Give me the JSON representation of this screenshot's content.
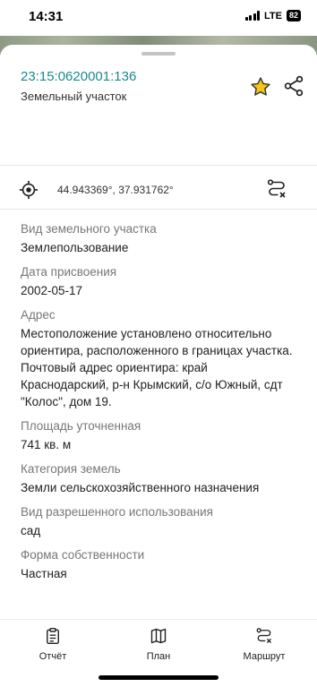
{
  "status_bar": {
    "time": "14:31",
    "network": "LTE",
    "battery": "82"
  },
  "parcel": {
    "cadastral_number": "23:15:0620001:136",
    "object_type": "Земельный участок",
    "coordinates": "44.943369°, 37.931762°",
    "accent_color": "#1a8a8a",
    "favorite_color": "#f5c518"
  },
  "details": [
    {
      "label": "Вид земельного участка",
      "value": "Землепользование"
    },
    {
      "label": "Дата присвоения",
      "value": "2002-05-17"
    },
    {
      "label": "Адрес",
      "value": "Местоположение установлено относительно ориентира, расположенного в границах участка. Почтовый адрес ориентира: край Краснодарский, р-н Крымский, с/о Южный, сдт \"Колос\", дом 19."
    },
    {
      "label": "Площадь уточненная",
      "value": "741 кв. м"
    },
    {
      "label": "Категория земель",
      "value": "Земли сельскохозяйственного назначения"
    },
    {
      "label": "Вид разрешенного использования",
      "value": "сад"
    },
    {
      "label": "Форма собственности",
      "value": "Частная"
    }
  ],
  "bottom_nav": [
    {
      "label": "Отчёт",
      "icon": "clipboard-icon"
    },
    {
      "label": "План",
      "icon": "map-icon"
    },
    {
      "label": "Маршрут",
      "icon": "route-icon"
    }
  ]
}
